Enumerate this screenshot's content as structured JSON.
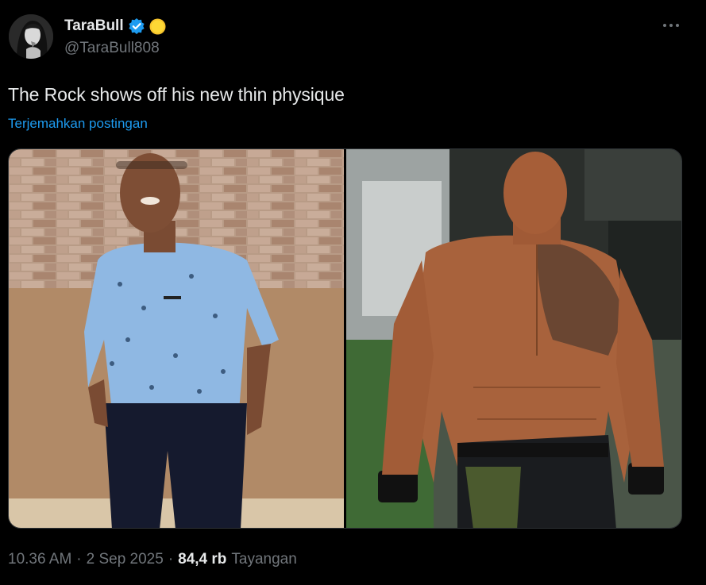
{
  "author": {
    "display_name": "TaraBull",
    "handle": "@TaraBull808",
    "verified_color": "#1d9bf0"
  },
  "tweet": {
    "text": "The Rock shows off his new thin physique",
    "translate_label": "Terjemahkan postingan"
  },
  "meta": {
    "time": "10.36 AM",
    "date": "2 Sep 2025",
    "separator": "·",
    "views_count": "84,4 rb",
    "views_label": "Tayangan"
  },
  "icons": {
    "more": "more-horizontal-icon",
    "verified": "verified-badge-icon",
    "emoji": "yellow-circle-emoji-icon"
  },
  "colors": {
    "background": "#000000",
    "text_primary": "#e7e9ea",
    "text_secondary": "#71767b",
    "link": "#1d9bf0"
  }
}
